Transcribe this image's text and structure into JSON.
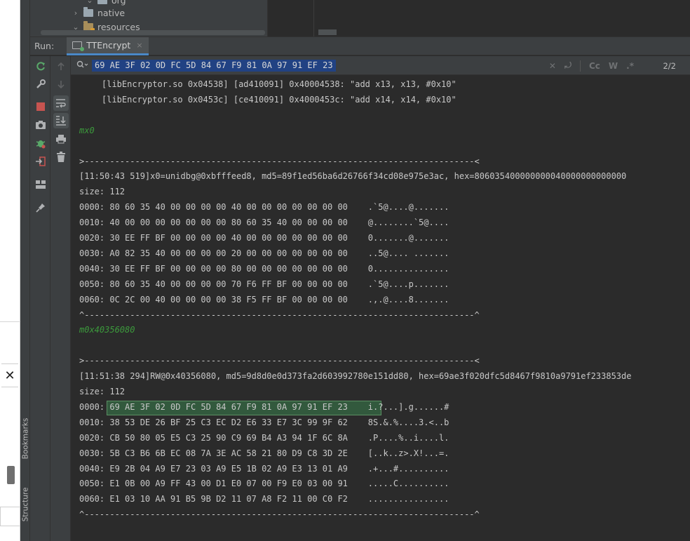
{
  "project_tree": {
    "items": [
      {
        "label": "org",
        "expanded": true
      },
      {
        "label": "native",
        "expanded": false
      },
      {
        "label": "resources",
        "expanded": true
      }
    ]
  },
  "side_tabs": {
    "bookmarks": "Bookmarks",
    "structure": "Structure"
  },
  "left_window": {
    "close_glyph": "✕"
  },
  "run": {
    "label": "Run:",
    "tab_title": "TTEncrypt",
    "tab_close": "×"
  },
  "find": {
    "query": "69 AE 3F 02 0D FC 5D 84 67 F9 81 0A 97 91 EF 23",
    "match_case": "Cc",
    "words": "W",
    "regex": ".*",
    "match_count": "2/2"
  },
  "icons": {
    "run_toolbar": [
      "rerun-icon",
      "settings-wrench-icon",
      "stop-icon",
      "camera-icon",
      "debug-bug-icon",
      "exit-icon",
      "layout-icon",
      "pin-icon"
    ],
    "console_toolbar": [
      "up-arrow-icon",
      "down-arrow-icon",
      "soft-wrap-icon",
      "scroll-to-end-icon",
      "print-icon",
      "trash-icon"
    ]
  },
  "console": {
    "lines": [
      {
        "text": "[libEncryptor.so 0x04538] [ad410091] 0x40004538: \"add x13, x13, #0x10\"",
        "style": "normal",
        "indent": true
      },
      {
        "text": "[libEncryptor.so 0x0453c] [ce410091] 0x4000453c: \"add x14, x14, #0x10\"",
        "style": "normal",
        "indent": true
      },
      {
        "text": "",
        "style": "normal"
      },
      {
        "text": "mx0",
        "style": "green"
      },
      {
        "text": "",
        "style": "normal"
      },
      {
        "text": ">-----------------------------------------------------------------------------<",
        "style": "normal"
      },
      {
        "text": "[11:50:43 519]x0=unidbg@0xbfffeed8, md5=89f1ed56ba6d26766f34cd08e975e3ac, hex=806035400000000040000000000000",
        "style": "normal"
      },
      {
        "text": "size: 112",
        "style": "normal"
      },
      {
        "text": "0000: 80 60 35 40 00 00 00 00 40 00 00 00 00 00 00 00    .`5@....@.......",
        "style": "normal"
      },
      {
        "text": "0010: 40 00 00 00 00 00 00 00 80 60 35 40 00 00 00 00    @........`5@....",
        "style": "normal"
      },
      {
        "text": "0020: 30 EE FF BF 00 00 00 00 40 00 00 00 00 00 00 00    0.......@.......",
        "style": "normal"
      },
      {
        "text": "0030: A0 82 35 40 00 00 00 00 20 00 00 00 00 00 00 00    ..5@.... .......",
        "style": "normal"
      },
      {
        "text": "0040: 30 EE FF BF 00 00 00 00 80 00 00 00 00 00 00 00    0...............",
        "style": "normal"
      },
      {
        "text": "0050: 80 60 35 40 00 00 00 00 70 F6 FF BF 00 00 00 00    .`5@....p.......",
        "style": "normal"
      },
      {
        "text": "0060: 0C 2C 00 40 00 00 00 00 38 F5 FF BF 00 00 00 00    .,.@....8.......",
        "style": "normal"
      },
      {
        "text": "^-----------------------------------------------------------------------------^",
        "style": "normal"
      },
      {
        "text": "m0x40356080",
        "style": "green"
      },
      {
        "text": "",
        "style": "normal"
      },
      {
        "text": ">-----------------------------------------------------------------------------<",
        "style": "normal"
      },
      {
        "text": "[11:51:38 294]RW@0x40356080, md5=9d8d0e0d373fa2d603992780e151dd80, hex=69ae3f020dfc5d8467f9810a9791ef233853de",
        "style": "normal"
      },
      {
        "text": "size: 112",
        "style": "normal"
      },
      {
        "text": "0000: 69 AE 3F 02 0D FC 5D 84 67 F9 81 0A 97 91 EF 23    i.?...].g......#",
        "style": "normal"
      },
      {
        "text": "0010: 38 53 DE 26 BF 25 C3 EC D2 E6 33 E7 3C 99 9F 62    8S.&.%....3.<..b",
        "style": "normal"
      },
      {
        "text": "0020: CB 50 80 05 E5 C3 25 90 C9 69 B4 A3 94 1F 6C 8A    .P....%..i....l.",
        "style": "normal"
      },
      {
        "text": "0030: 5B C3 B6 6B EC 08 7A 3E AC 58 21 80 D9 C8 3D 2E    [..k..z>.X!...=.",
        "style": "normal"
      },
      {
        "text": "0040: E9 2B 04 A9 E7 23 03 A9 E5 1B 02 A9 E3 13 01 A9    .+...#..........",
        "style": "normal"
      },
      {
        "text": "0050: E1 0B 00 A9 FF 43 00 D1 E0 07 00 F9 E0 03 00 91    .....C..........",
        "style": "normal"
      },
      {
        "text": "0060: E1 03 10 AA 91 B5 9B D2 11 07 A8 F2 11 00 C0 F2    ................",
        "style": "normal"
      },
      {
        "text": "^-----------------------------------------------------------------------------^",
        "style": "normal"
      }
    ]
  }
}
